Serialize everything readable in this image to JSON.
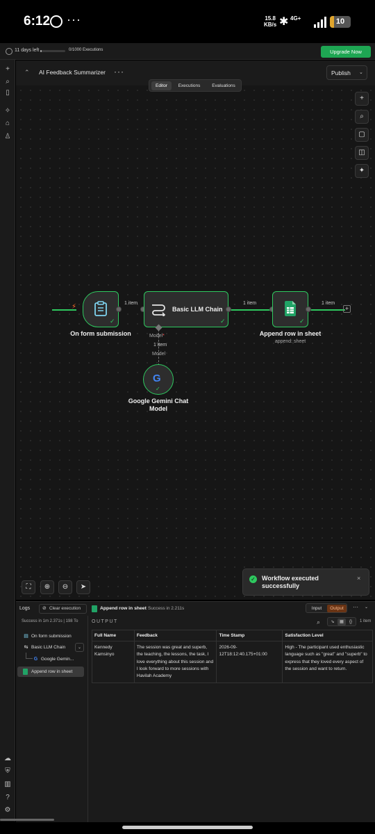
{
  "status_bar": {
    "time": "6:12",
    "more": "···",
    "speed_value": "15.8",
    "speed_unit": "KB/s",
    "network": "4G+",
    "battery": "10"
  },
  "trial": {
    "days_left": "11 days left",
    "executions": "0/1000 Executions",
    "executions_fraction": 0.0,
    "upgrade_label": "Upgrade Now"
  },
  "header": {
    "workflow_title": "AI Feedback Summarizer",
    "more": "···",
    "publish_label": "Publish"
  },
  "tabs": [
    "Editor",
    "Executions",
    "Evaluations"
  ],
  "canvas": {
    "nodes": {
      "trigger": {
        "label": "On form submission"
      },
      "llm": {
        "label": "Basic LLM Chain",
        "model_port": "Model",
        "required_mark": "*"
      },
      "sheet": {
        "label": "Append row in sheet",
        "sub": "append: sheet"
      },
      "gemini": {
        "label": "Google Gemini Chat Model"
      }
    },
    "connections": {
      "trigger_to_llm": "1 item",
      "llm_to_sheet": "1 item",
      "sheet_out": "1 item",
      "gemini_to_llm": "1 item",
      "gemini_port": "Model"
    },
    "add_symbol": "+"
  },
  "toast": {
    "message": "Workflow executed successfully",
    "close": "×"
  },
  "logs": {
    "title": "Logs",
    "clear_label": "Clear execution",
    "summary": "Success in 1m 2.371s | 198 To",
    "items": [
      {
        "label": "On form submission",
        "icon": "clipboard-icon"
      },
      {
        "label": "Basic LLM Chain",
        "icon": "chain-icon"
      },
      {
        "label": "Google Gemin...",
        "icon": "google-icon"
      },
      {
        "label": "Append row in sheet",
        "icon": "sheets-icon"
      }
    ],
    "toggle": "⌄",
    "output": {
      "node_title": "Append row in sheet",
      "status": "Success in 2.211s",
      "input_label": "Input",
      "output_label": "Output",
      "more": "···",
      "section_label": "OUTPUT",
      "item_count": "1 item",
      "columns": [
        "Full Name",
        "Feedback",
        "Time Stamp",
        "Satisfaction Level"
      ],
      "rows": [
        {
          "full_name": "Kennedy Kamsinyo",
          "feedback": "The session was great and superb, the teaching, the lessons, the task, I love everything about this session and I look forward to more sessions with Havilah Academy",
          "time_stamp": "2026-09-12T18:12:40.175+01:00",
          "satisfaction": "High - The participant used enthusiastic language such as \"great\" and \"superb\" to express that they loved every aspect of the session and want to return."
        }
      ]
    }
  },
  "colors": {
    "accent_green": "#2ec95f",
    "upgrade_green": "#1ea653",
    "canvas_bg": "#161616",
    "output_active": "#6a3414"
  }
}
